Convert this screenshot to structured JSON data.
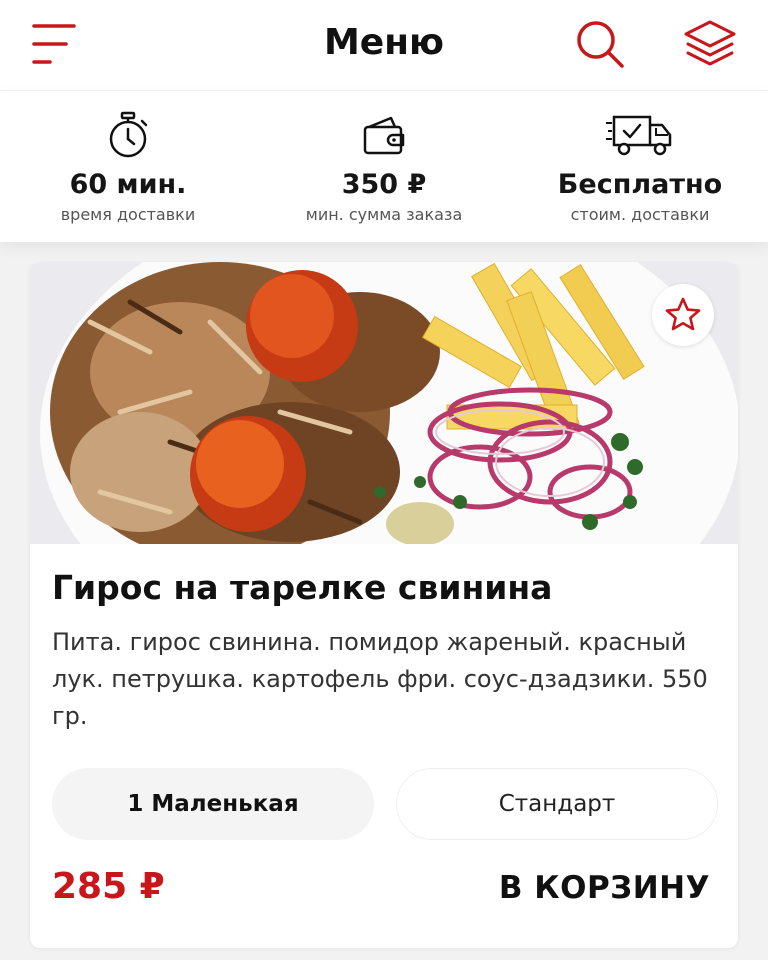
{
  "header": {
    "title": "Меню",
    "icons": {
      "menu": "hamburger-menu-icon",
      "search": "search-icon",
      "layers": "layers-icon"
    },
    "accent_color": "#c8161b"
  },
  "info_bar": {
    "items": [
      {
        "icon": "stopwatch-icon",
        "value": "60 мин.",
        "label": "время доставки"
      },
      {
        "icon": "wallet-icon",
        "value": "350 ₽",
        "label": "мин. сумма заказа"
      },
      {
        "icon": "delivery-truck-icon",
        "value": "Бесплатно",
        "label": "стоим. доставки"
      }
    ]
  },
  "product": {
    "image": "gyros-plate-photo",
    "favorite_icon": "star-outline-icon",
    "title": "Гирос на тарелке свинина",
    "description": "Пита. гирос свинина. помидор жареный. красный лук. петрушка. картофель фри. соус-дзадзики. 550 гр.",
    "options": [
      {
        "label": "1 Маленькая",
        "selected": true
      },
      {
        "label": "Стандарт",
        "selected": false
      }
    ],
    "price": "285 ₽",
    "cart_label": "В КОРЗИНУ"
  }
}
